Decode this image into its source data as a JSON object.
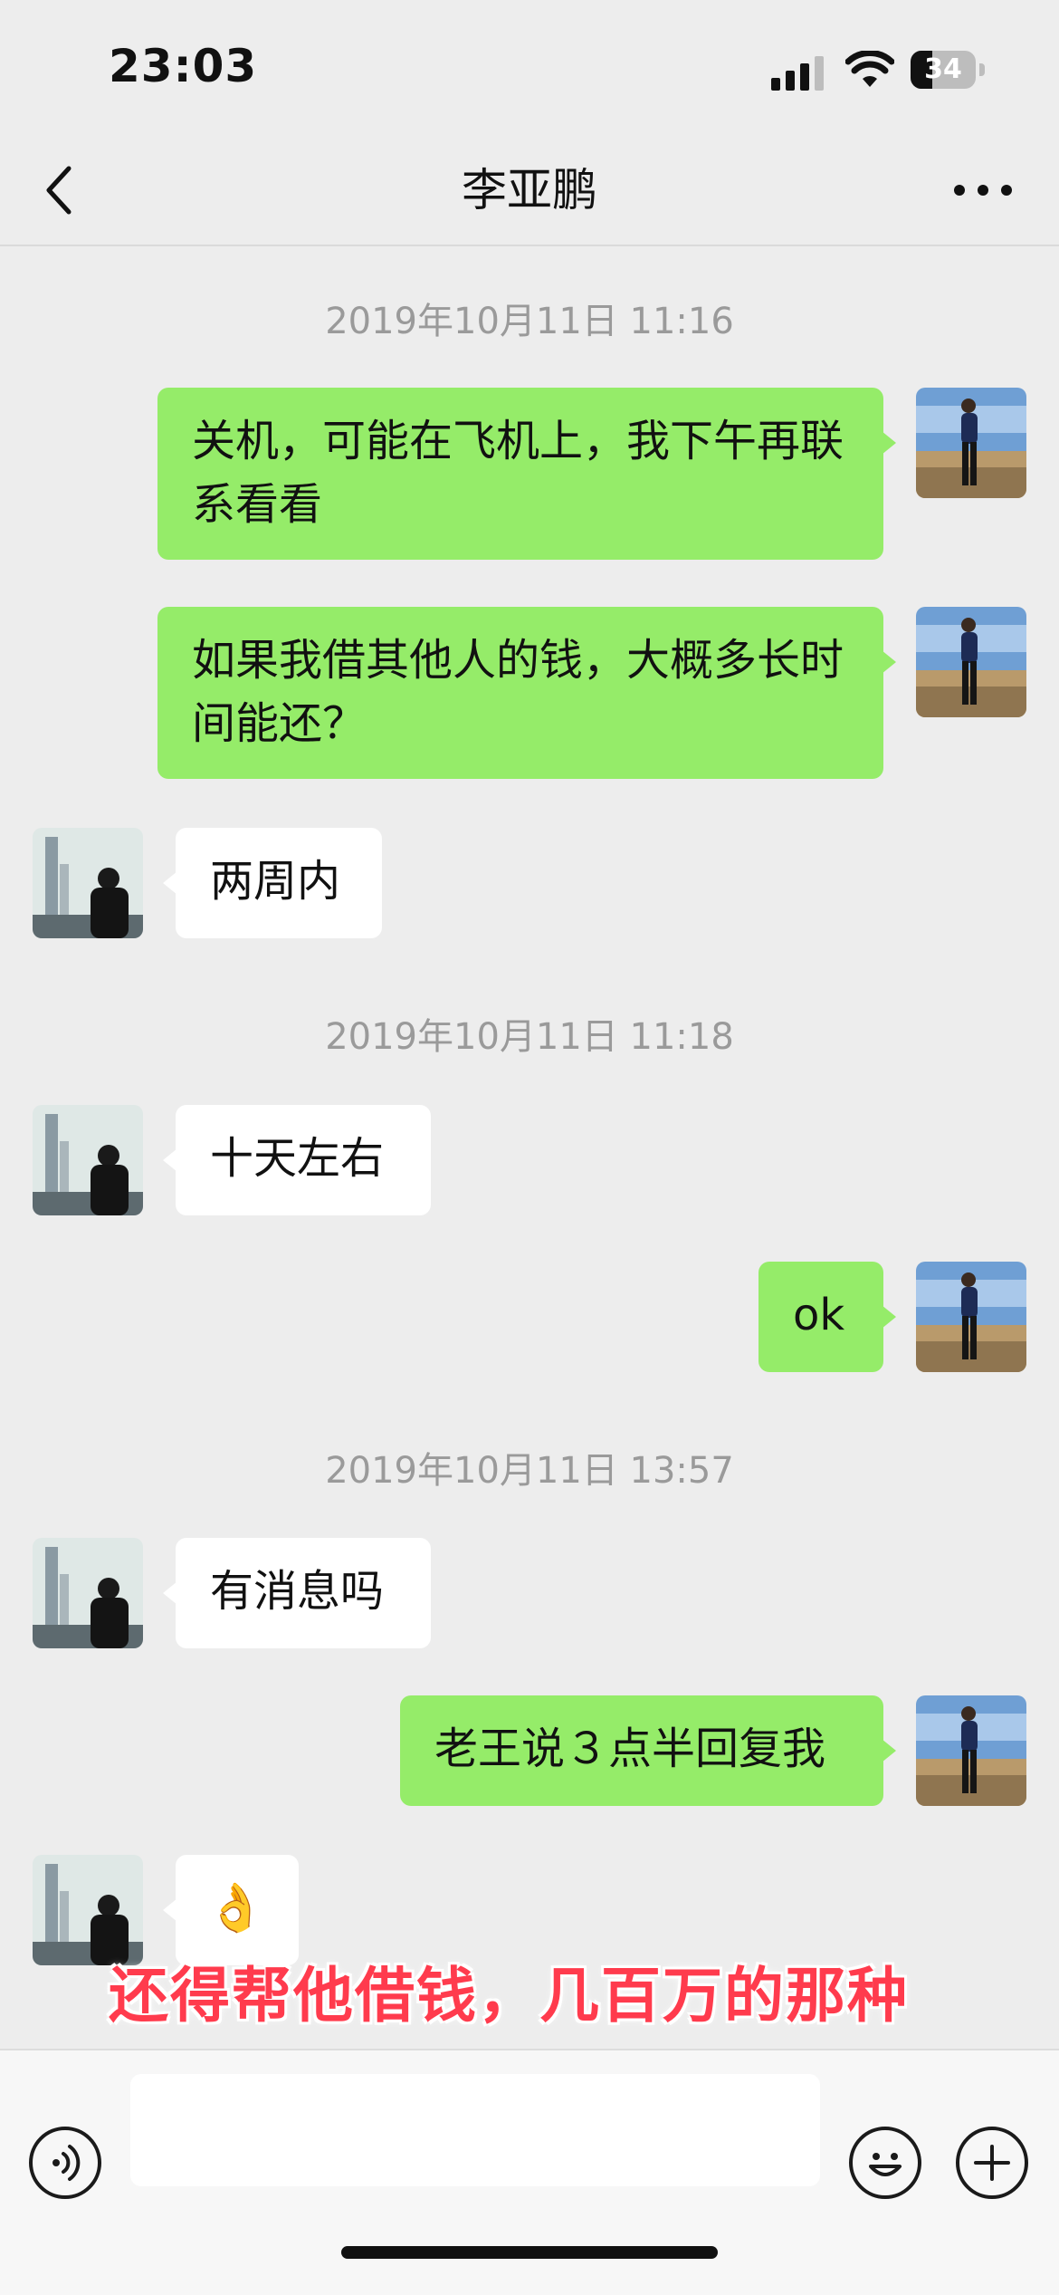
{
  "status_bar": {
    "time": "23:03",
    "battery": "34",
    "battery_level": 0.34
  },
  "header": {
    "title": "李亚鹏"
  },
  "messages": [
    {
      "type": "time",
      "text": "2019年10月11日 11:16"
    },
    {
      "type": "msg",
      "from": "me",
      "text": "关机，可能在飞机上，我下午再联系看看"
    },
    {
      "type": "msg",
      "from": "me",
      "text": "如果我借其他人的钱，大概多长时间能还？"
    },
    {
      "type": "msg",
      "from": "other",
      "text": "两周内"
    },
    {
      "type": "time",
      "text": "2019年10月11日 11:18"
    },
    {
      "type": "msg",
      "from": "other",
      "text": "十天左右"
    },
    {
      "type": "msg",
      "from": "me",
      "text": "ok"
    },
    {
      "type": "time",
      "text": "2019年10月11日 13:57"
    },
    {
      "type": "msg",
      "from": "other",
      "text": "有消息吗"
    },
    {
      "type": "msg",
      "from": "me",
      "text": "老王说３点半回复我"
    },
    {
      "type": "msg",
      "from": "other",
      "text": "👌"
    }
  ],
  "overlay_caption": "还得帮他借钱，几百万的那种",
  "input": {
    "value": "",
    "placeholder": ""
  },
  "icons": {
    "back": "chevron-left-icon",
    "more": "more-dots-icon",
    "voice": "voice-icon",
    "emoji": "emoji-icon",
    "add": "plus-icon"
  },
  "colors": {
    "my_bubble": "#95ec69",
    "other_bubble": "#ffffff",
    "background": "#ededed",
    "caption": "#ff3b4d"
  }
}
